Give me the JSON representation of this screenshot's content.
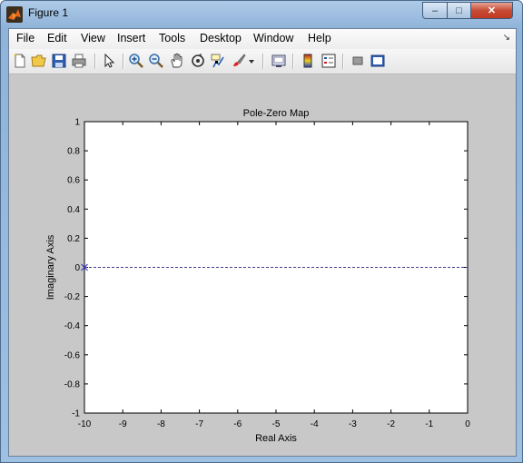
{
  "window": {
    "title": "Figure 1",
    "controls": {
      "minimize": "–",
      "maximize": "□",
      "close": "✕"
    }
  },
  "menu": {
    "items": [
      "File",
      "Edit",
      "View",
      "Insert",
      "Tools",
      "Desktop",
      "Window",
      "Help"
    ],
    "overflow_arrow": "↘"
  },
  "toolbar": {
    "icons": [
      "new-figure-icon",
      "open-file-icon",
      "save-icon",
      "print-icon",
      "pointer-icon",
      "zoom-in-icon",
      "zoom-out-icon",
      "pan-hand-icon",
      "rotate-3d-icon",
      "data-cursor-icon",
      "brush-icon",
      "brush-dropdown-icon",
      "link-plot-icon",
      "insert-colorbar-icon",
      "insert-legend-icon",
      "hide-plot-tools-icon",
      "show-plot-tools-icon"
    ]
  },
  "colors": {
    "plot_bg": "#ffffff",
    "figure_bg": "#c8c8c8",
    "pole_marker": "#3b3bc0",
    "zero_line": "#3d3d8c"
  },
  "chart_data": {
    "type": "scatter",
    "title": "Pole-Zero Map",
    "xlabel": "Real Axis",
    "ylabel": "Imaginary Axis",
    "xlim": [
      -10,
      0
    ],
    "ylim": [
      -1,
      1
    ],
    "xticks": [
      "-10",
      "-9",
      "-8",
      "-7",
      "-6",
      "-5",
      "-4",
      "-3",
      "-2",
      "-1",
      "0"
    ],
    "yticks": [
      "-1",
      "-0.8",
      "-0.6",
      "-0.4",
      "-0.2",
      "0",
      "0.2",
      "0.4",
      "0.6",
      "0.8",
      "1"
    ],
    "grid": false,
    "poles": [
      {
        "x": -10,
        "y": 0
      }
    ],
    "reference_line_y": 0
  }
}
